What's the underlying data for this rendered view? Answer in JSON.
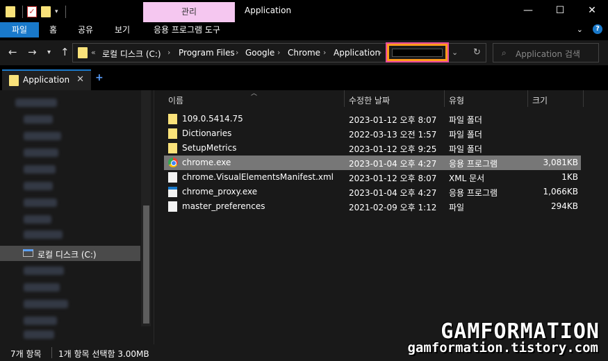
{
  "window": {
    "title": "Application",
    "context_tab": "관리",
    "controls": {
      "minimize": "—",
      "maximize": "☐",
      "close": "✕"
    }
  },
  "ribbon": {
    "tabs": [
      "파일",
      "홈",
      "공유",
      "보기",
      "응용 프로그램 도구"
    ],
    "active_tab": "파일",
    "expand_glyph": "⌄",
    "help": "?"
  },
  "address": {
    "overflow": "«",
    "crumbs": [
      "로컬 디스크 (C:)",
      "Program Files",
      "Google",
      "Chrome",
      "Application"
    ],
    "search_placeholder": "Application 검색"
  },
  "folder_tab": {
    "label": "Application",
    "close": "✕",
    "add": "+"
  },
  "nav_pane": {
    "selected_drive": "로컬 디스크 (C:)"
  },
  "columns": [
    "이름",
    "수정한 날짜",
    "유형",
    "크기"
  ],
  "files": [
    {
      "name": "109.0.5414.75",
      "date": "2023-01-12 오후 8:07",
      "type": "파일 폴더",
      "size": "",
      "icon": "folder-icon"
    },
    {
      "name": "Dictionaries",
      "date": "2022-03-13 오전 1:57",
      "type": "파일 폴더",
      "size": "",
      "icon": "folder-icon"
    },
    {
      "name": "SetupMetrics",
      "date": "2023-01-12 오후 9:25",
      "type": "파일 폴더",
      "size": "",
      "icon": "folder-icon"
    },
    {
      "name": "chrome.exe",
      "date": "2023-01-04 오후 4:27",
      "type": "응용 프로그램",
      "size": "3,081KB",
      "icon": "chrome-icon",
      "selected": true
    },
    {
      "name": "chrome.VisualElementsManifest.xml",
      "date": "2023-01-12 오후 8:07",
      "type": "XML 문서",
      "size": "1KB",
      "icon": "document-icon"
    },
    {
      "name": "chrome_proxy.exe",
      "date": "2023-01-04 오후 4:27",
      "type": "응용 프로그램",
      "size": "1,066KB",
      "icon": "application-icon"
    },
    {
      "name": "master_preferences",
      "date": "2021-02-09 오후 1:12",
      "type": "파일",
      "size": "294KB",
      "icon": "document-icon"
    }
  ],
  "status": {
    "count": "7개 항목",
    "selection": "1개 항목 선택함 3.00MB"
  },
  "watermark": {
    "line1": "GAMFORMATION",
    "line2": "gamformation.tistory.com"
  },
  "colors": {
    "accent": "#1979ca",
    "context_tab": "#f5c7f0",
    "folder": "#f9e27a",
    "highlight_orange": "#ff9a1a",
    "highlight_pink": "#e84b9d"
  }
}
